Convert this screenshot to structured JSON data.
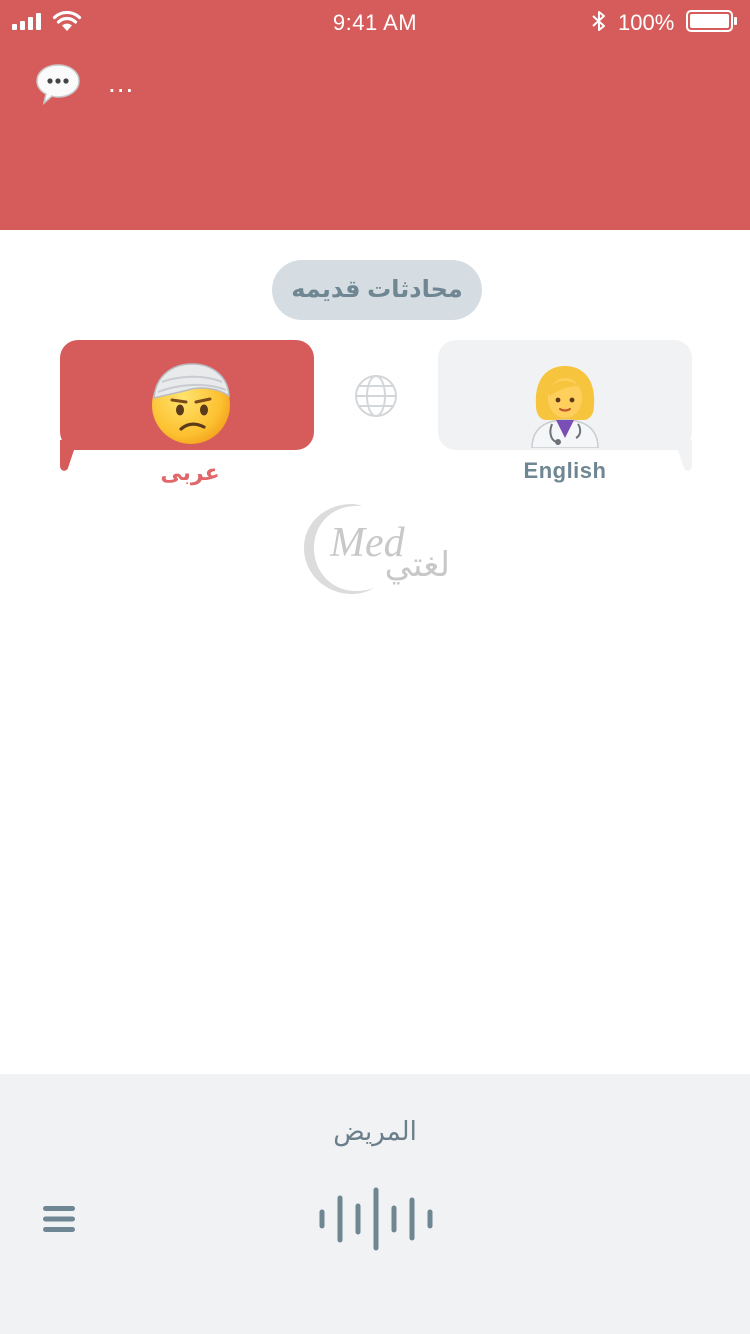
{
  "status_bar": {
    "time": "9:41 AM",
    "battery_percent": "100%",
    "battery_level": 1.0
  },
  "header": {
    "chat_icon": "speech-bubble-icon",
    "more_label": "...",
    "color": "#d65c5c"
  },
  "old_conversations_label": "محادثات قديمه",
  "participants": {
    "patient": {
      "emoji": "🤕",
      "language_label": "عربى",
      "color": "#d65c5c"
    },
    "doctor": {
      "emoji": "👩‍⚕️",
      "language_label": "English",
      "color": "#f1f2f4"
    },
    "switch_icon": "globe-icon"
  },
  "logo": {
    "latin": "Med",
    "arabic": "لغتي"
  },
  "bottom_bar": {
    "role_label": "المريض",
    "menu_icon": "hamburger-menu-icon",
    "voice_icon": "voice-waveform-icon"
  }
}
